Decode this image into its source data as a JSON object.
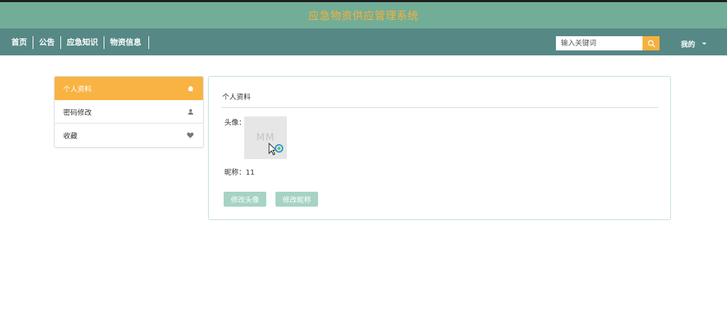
{
  "header": {
    "title": "应急物资供应管理系统"
  },
  "nav": {
    "links": [
      "首页",
      "公告",
      "应急知识",
      "物资信息"
    ],
    "search_placeholder": "输入关键词",
    "mine_label": "我的"
  },
  "sidebar": {
    "items": [
      {
        "label": "个人资料",
        "icon": "home-icon",
        "active": true
      },
      {
        "label": "密码修改",
        "icon": "user-icon",
        "active": false
      },
      {
        "label": "收藏",
        "icon": "heart-icon",
        "active": false
      }
    ]
  },
  "profile": {
    "title": "个人资料",
    "avatar_label": "头像：",
    "avatar_placeholder": "MM",
    "nickname_label": "昵称：",
    "nickname_value": "11",
    "change_avatar_button": "修改头像",
    "change_nickname_button": "修改昵称"
  },
  "colors": {
    "title_bar": "#72ad97",
    "nav_bar": "#568886",
    "accent": "#f9b343",
    "button": "#a6d3c3"
  }
}
